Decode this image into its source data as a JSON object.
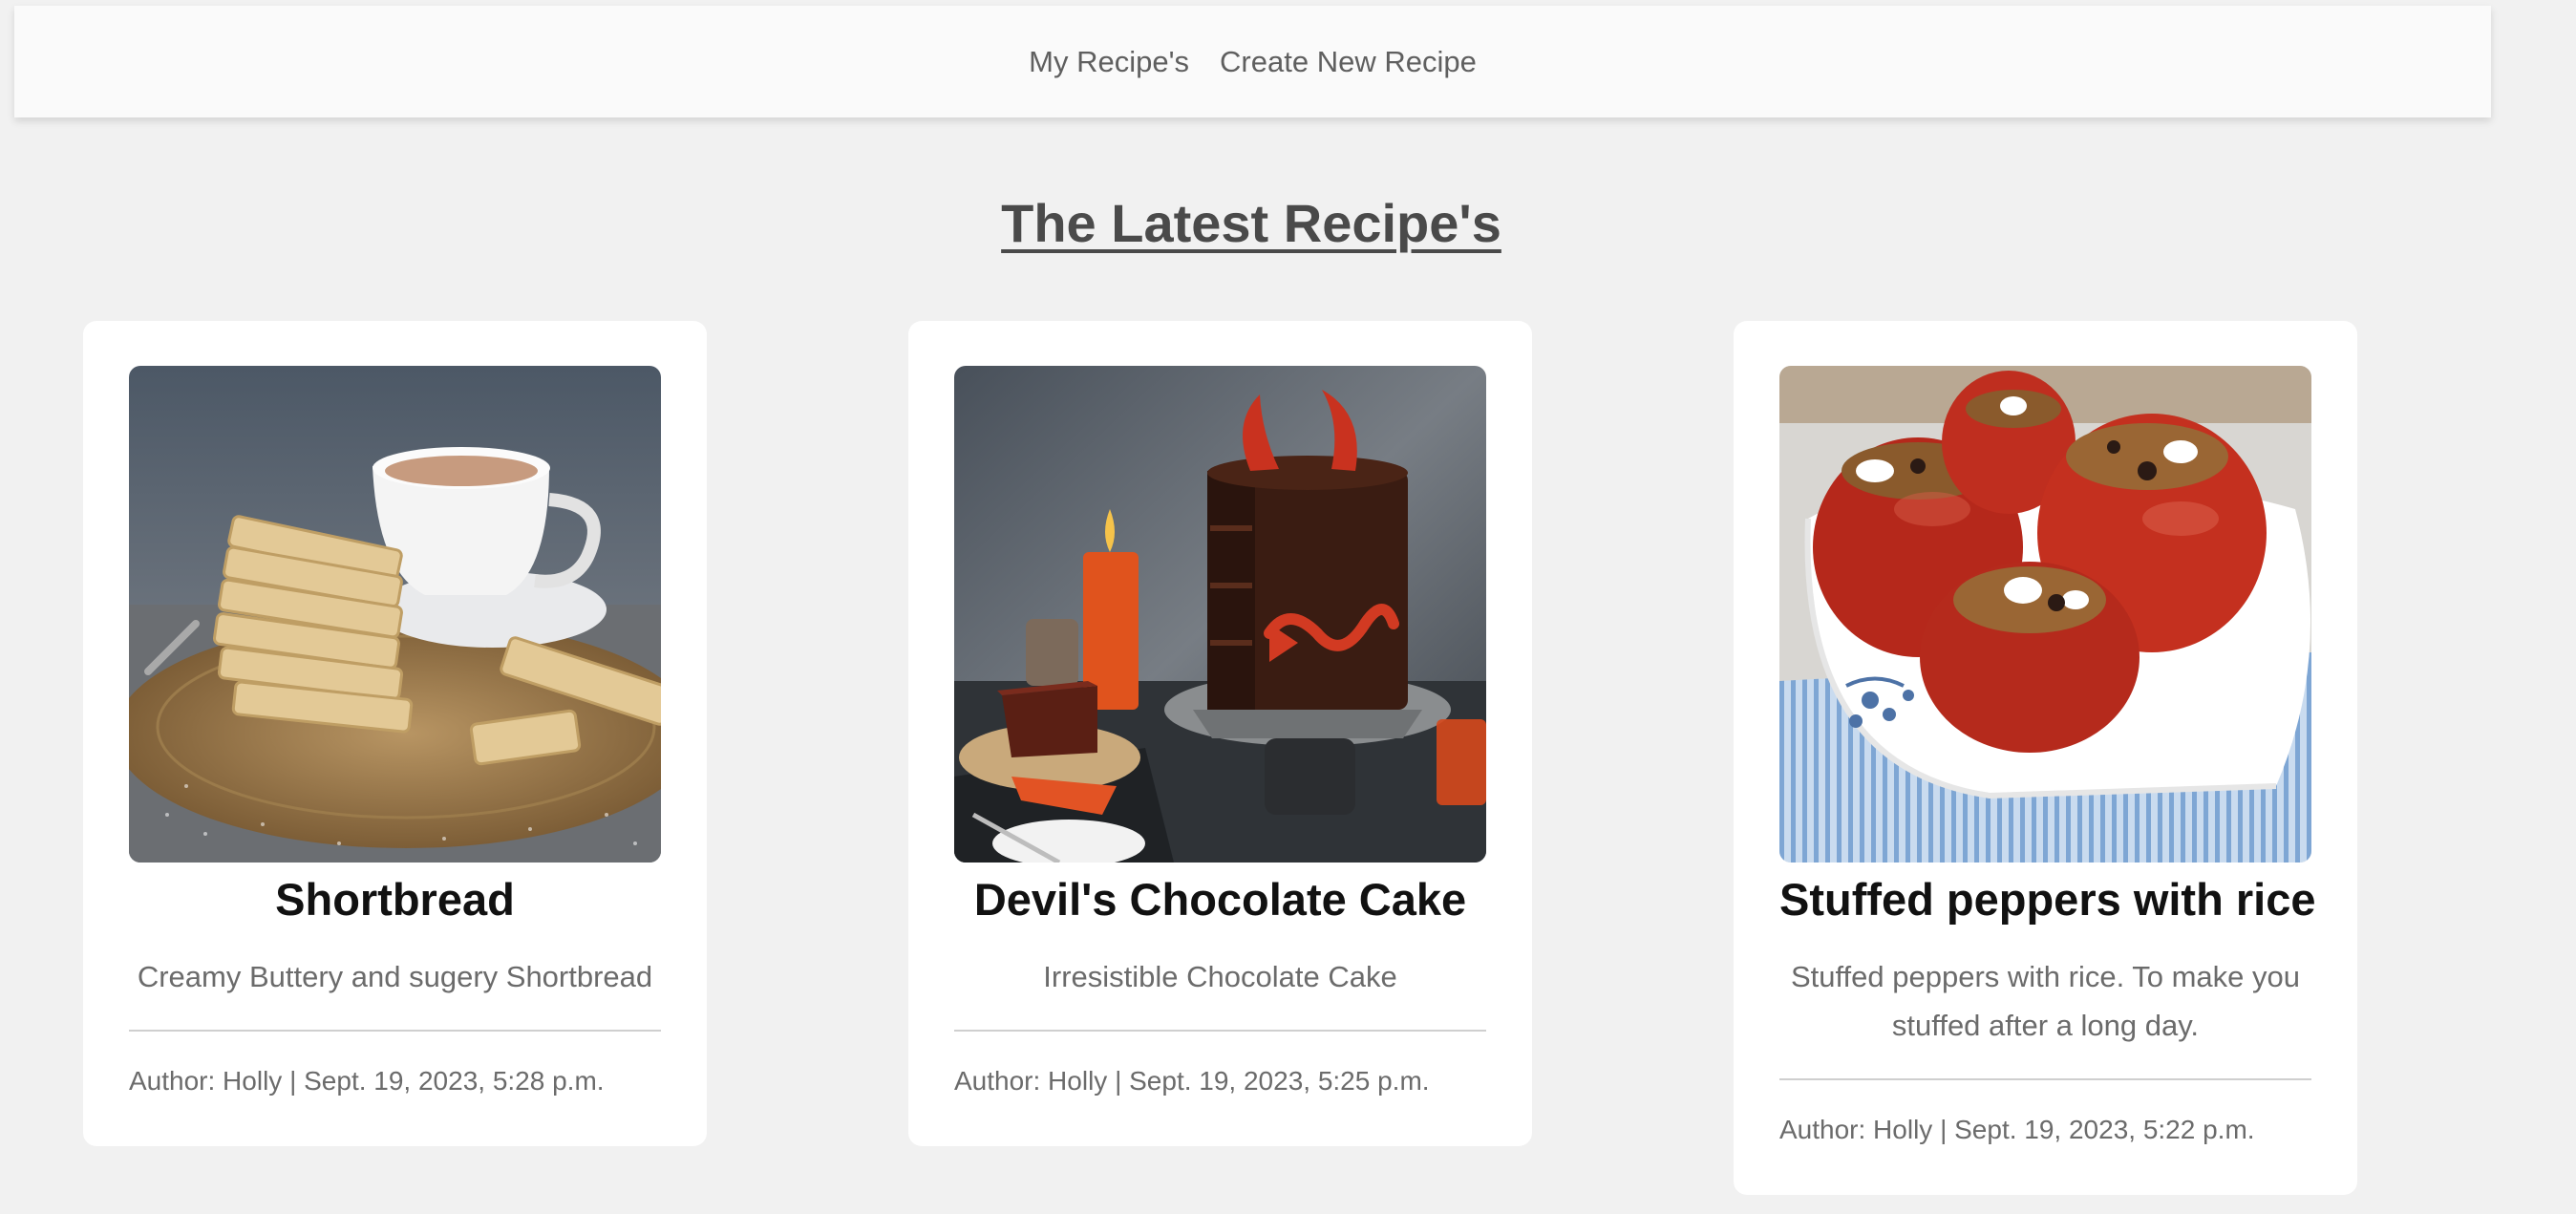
{
  "nav": {
    "links": [
      "My Recipe's",
      "Create New Recipe"
    ]
  },
  "page_title": "The Latest Recipe's",
  "recipes": [
    {
      "title": "Shortbread",
      "description": "Creamy Buttery and sugery Shortbread",
      "meta": "Author: Holly | Sept. 19, 2023, 5:28 p.m."
    },
    {
      "title": "Devil's Chocolate Cake",
      "description": "Irresistible Chocolate Cake",
      "meta": "Author: Holly | Sept. 19, 2023, 5:25 p.m."
    },
    {
      "title": "Stuffed peppers with rice",
      "description": "Stuffed peppers with rice. To make you stuffed after a long day.",
      "meta": "Author: Holly | Sept. 19, 2023, 5:22 p.m."
    }
  ],
  "colors": {
    "page_background": "#f1f1f1",
    "navbar_background": "#fafafa",
    "card_background": "#ffffff",
    "title_color": "#4a4a4a",
    "muted_text": "#6b6b6b"
  }
}
